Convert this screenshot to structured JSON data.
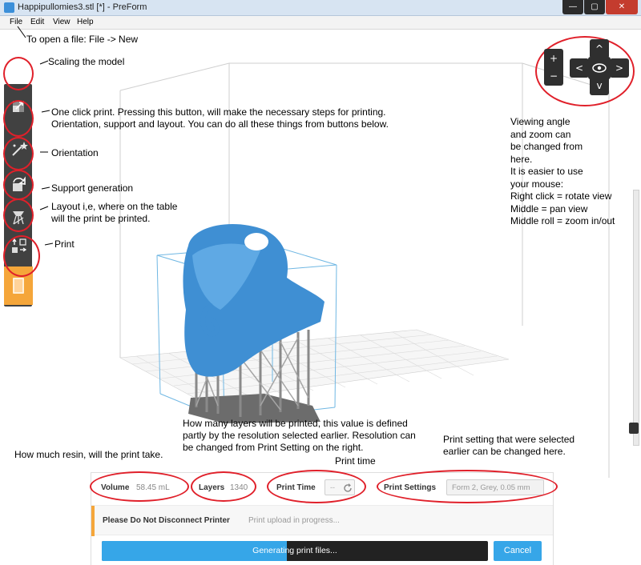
{
  "window": {
    "title": "Happipullomies3.stl [*] - PreForm",
    "controls": {
      "minimize": "—",
      "maximize": "▢",
      "close": "✕"
    }
  },
  "menu": {
    "items": [
      "File",
      "Edit",
      "View",
      "Help"
    ]
  },
  "view": {
    "zoom_in": "+",
    "zoom_out": "−",
    "up": "^",
    "down": "v",
    "left": "<",
    "right": ">",
    "center_icon": "eye-icon"
  },
  "annotations": {
    "file": "To open a file: File -> New",
    "scaling": "Scaling the model",
    "one_click_line1": "One click print. Pressing this button, will make the necessary steps for printing.",
    "one_click_line2": "Orientation, support and layout. You can do all these things from buttons below.",
    "orientation": "Orientation",
    "support": "Support generation",
    "layout_line1": "Layout i,e, where on the table",
    "layout_line2": "will the print be printed.",
    "print": "Print",
    "viewing": [
      "Viewing angle",
      "and zoom can",
      "be changed from",
      "here.",
      "It is easier to use",
      "your mouse:",
      "Right click = rotate view",
      "Middle = pan view",
      "Middle roll = zoom in/out"
    ],
    "layers_line1": "How many layers will be printed, this value is defined",
    "layers_line2": "partly by the resolution selected earlier. Resolution can",
    "layers_line3": "be changed from Print Setting on the right.",
    "resin": "How much resin, will the print take.",
    "print_time": "Print time",
    "settings_line1": "Print setting that were selected",
    "settings_line2": "earlier can be changed here."
  },
  "panel": {
    "volume_label": "Volume",
    "volume_value": "58.45 mL",
    "layers_label": "Layers",
    "layers_value": "1340",
    "print_time_label": "Print Time",
    "print_time_value": "--",
    "settings_label": "Print Settings",
    "settings_value": "Form 2, Grey, 0.05 mm",
    "status_title": "Please Do Not Disconnect Printer",
    "status_msg": "Print upload in progress...",
    "progress_label": "Generating print files...",
    "progress_fraction": 0.48,
    "cancel": "Cancel"
  }
}
